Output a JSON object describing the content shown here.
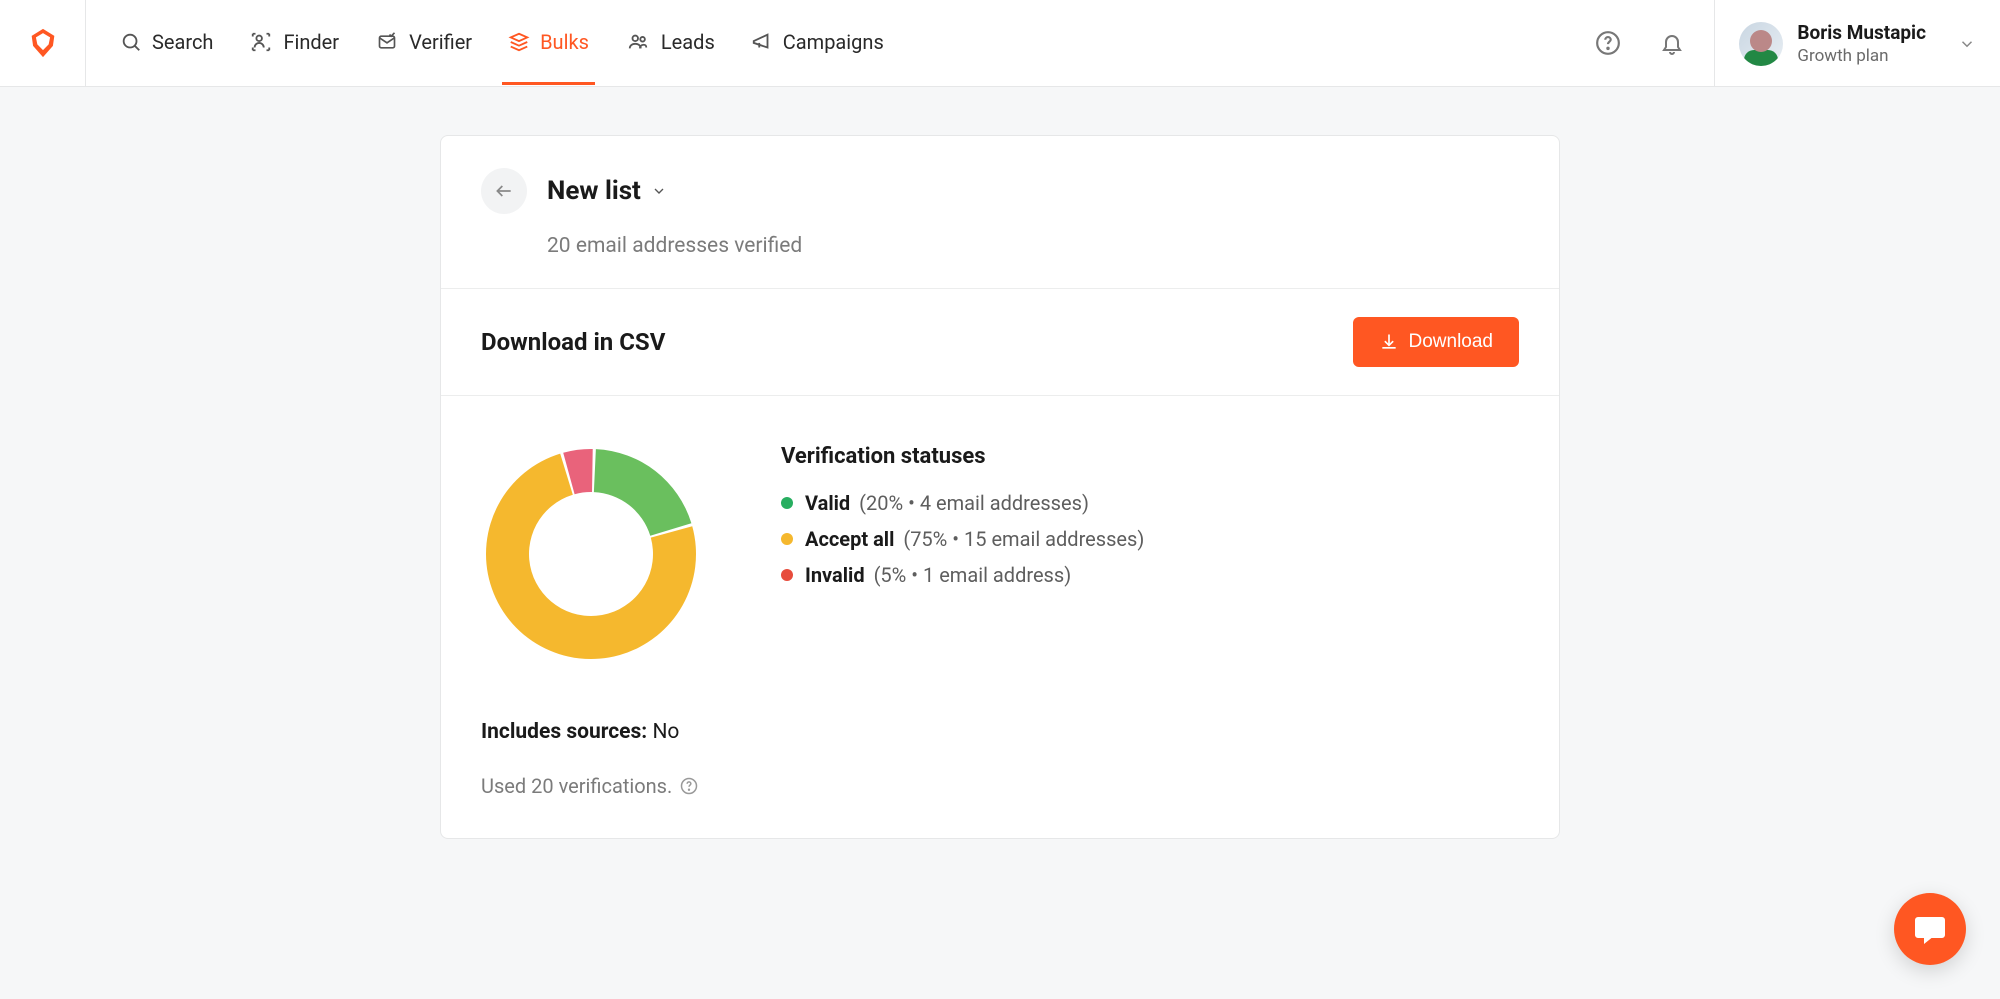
{
  "nav": {
    "items": [
      {
        "label": "Search",
        "icon": "search-icon"
      },
      {
        "label": "Finder",
        "icon": "finder-icon"
      },
      {
        "label": "Verifier",
        "icon": "verifier-icon"
      },
      {
        "label": "Bulks",
        "icon": "bulks-icon",
        "active": true
      },
      {
        "label": "Leads",
        "icon": "leads-icon"
      },
      {
        "label": "Campaigns",
        "icon": "campaigns-icon"
      }
    ]
  },
  "user": {
    "name": "Boris Mustapic",
    "plan": "Growth plan"
  },
  "list": {
    "title": "New list",
    "subtitle": "20 email addresses verified"
  },
  "download": {
    "title": "Download in CSV",
    "button_label": "Download"
  },
  "statuses": {
    "heading": "Verification statuses",
    "items": [
      {
        "key": "valid",
        "label": "Valid",
        "percent": 20.0,
        "count": 4,
        "count_label": "4 email addresses",
        "color": "#6abf5e"
      },
      {
        "key": "accept_all",
        "label": "Accept all",
        "percent": 75.0,
        "count": 15,
        "count_label": "15 email addresses",
        "color": "#f5b82e"
      },
      {
        "key": "invalid",
        "label": "Invalid",
        "percent": 5.0,
        "count": 1,
        "count_label": "1 email address",
        "color": "#e9637b"
      }
    ]
  },
  "includes_sources": {
    "label": "Includes sources:",
    "value": "No"
  },
  "used_verifications": "Used 20 verifications.",
  "chart_data": {
    "type": "pie",
    "title": "Verification statuses",
    "categories": [
      "Valid",
      "Accept all",
      "Invalid"
    ],
    "values": [
      20.0,
      75.0,
      5.0
    ],
    "colors": [
      "#6abf5e",
      "#f5b82e",
      "#e9637b"
    ],
    "counts": [
      4,
      15,
      1
    ],
    "donut": true
  }
}
